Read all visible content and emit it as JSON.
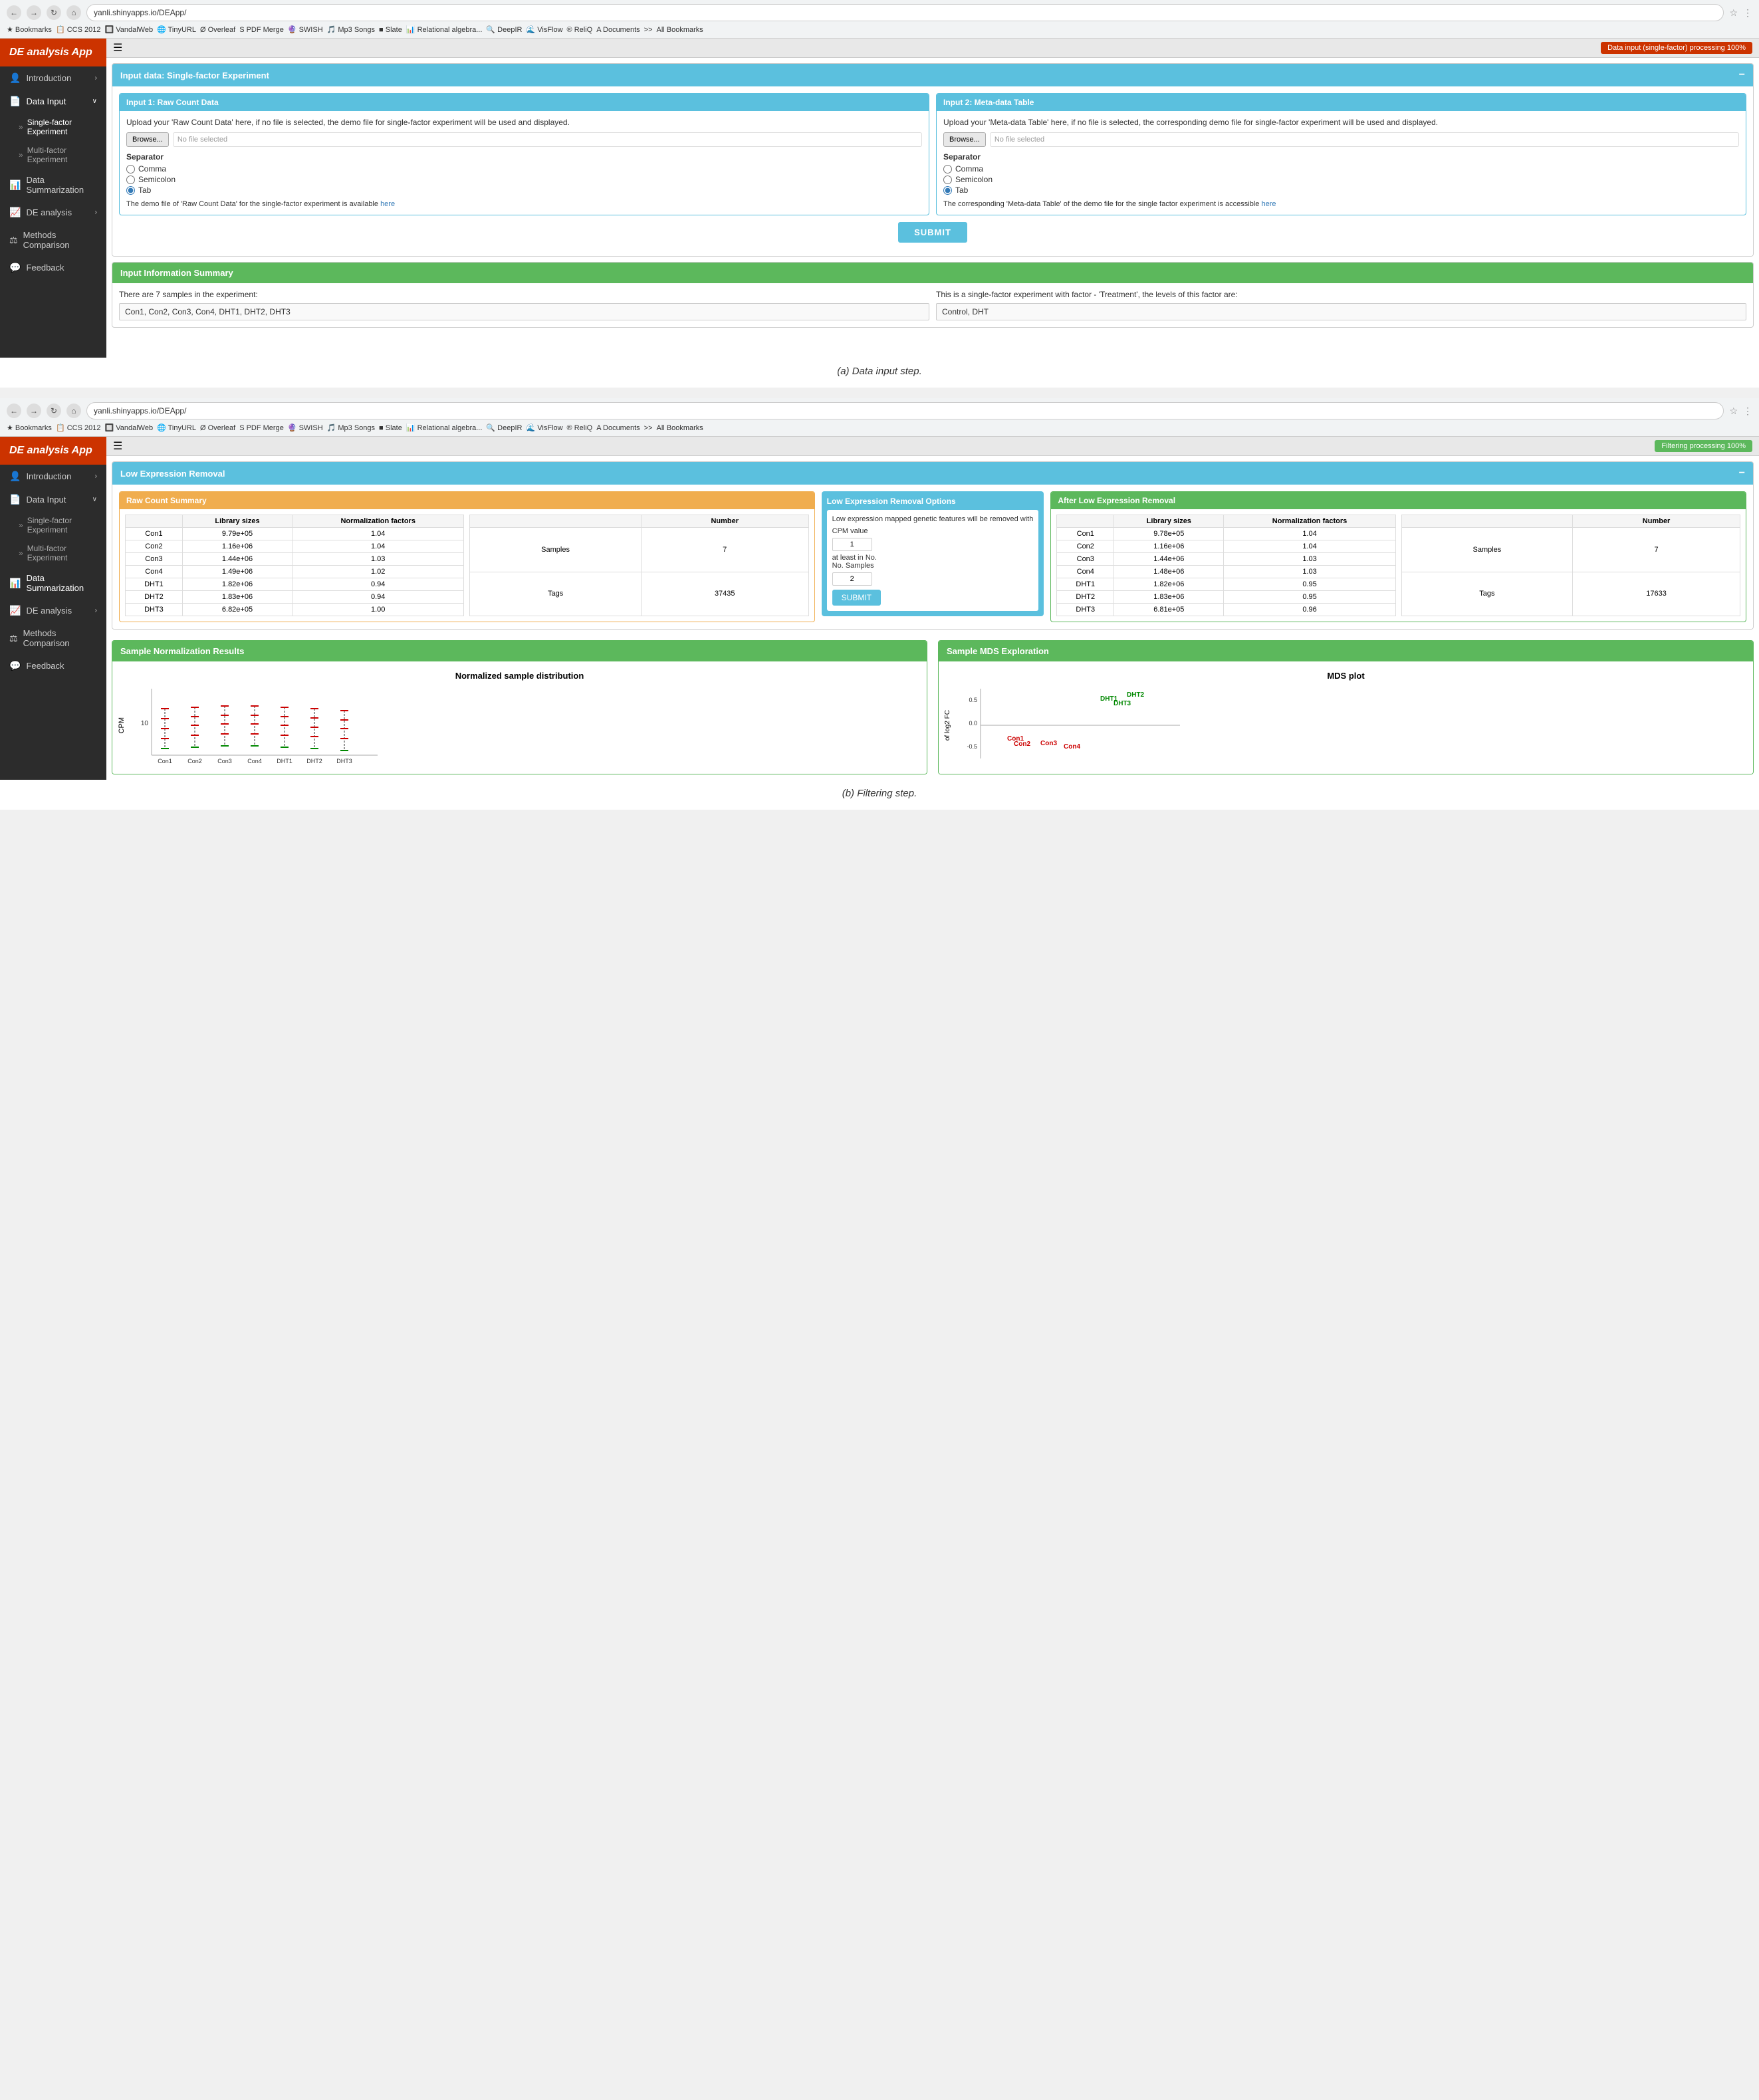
{
  "app": {
    "title": "DE analysis App",
    "url": "yanli.shinyapps.io/DEApp/"
  },
  "bookmarks": [
    "Bookmarks",
    "CCS 2012",
    "VandalWeb",
    "TinyURL",
    "Overleaf",
    "PDF Merge",
    "SWISH",
    "Mp3 Songs",
    "Slate",
    "Relational algebra...",
    "DeepIR",
    "VisFlow",
    "ReliQ",
    "Documents",
    ">>",
    "All Bookmarks"
  ],
  "sidebar": {
    "items": [
      {
        "id": "introduction",
        "label": "Introduction",
        "icon": "👤",
        "hasChevron": true
      },
      {
        "id": "data-input",
        "label": "Data Input",
        "icon": "📄",
        "hasChevron": true
      },
      {
        "id": "single-factor",
        "label": "Single-factor Experiment",
        "isSub": true
      },
      {
        "id": "multi-factor",
        "label": "Multi-factor Experiment",
        "isSub": true
      },
      {
        "id": "data-summarization",
        "label": "Data Summarization",
        "icon": "📊"
      },
      {
        "id": "de-analysis",
        "label": "DE analysis",
        "icon": "📈",
        "hasChevron": true
      },
      {
        "id": "methods-comparison",
        "label": "Methods Comparison",
        "icon": "💬"
      },
      {
        "id": "feedback",
        "label": "Feedback",
        "icon": "💬"
      }
    ]
  },
  "screenshot1": {
    "status_badge": "Data input (single-factor) processing 100%",
    "panel_title": "Input data: Single-factor Experiment",
    "input1": {
      "title": "Input 1: Raw Count Data",
      "description": "Upload your 'Raw Count Data' here, if no file is selected, the demo file for single-factor experiment will be used and displayed.",
      "browse_label": "Browse...",
      "file_placeholder": "No file selected",
      "separator_label": "Separator",
      "options": [
        "Comma",
        "Semicolon",
        "Tab"
      ],
      "selected": "Tab",
      "demo_text": "The demo file of 'Raw Count Data' for the single-factor experiment is available",
      "demo_link": "here"
    },
    "input2": {
      "title": "Input 2: Meta-data Table",
      "description": "Upload your 'Meta-data Table' here, if no file is selected, the corresponding demo file for single-factor experiment will be used and displayed.",
      "browse_label": "Browse...",
      "file_placeholder": "No file selected",
      "separator_label": "Separator",
      "options": [
        "Comma",
        "Semicolon",
        "Tab"
      ],
      "selected": "Tab",
      "demo_text": "The corresponding 'Meta-data Table' of the demo file for the single factor experiment is accessible",
      "demo_link": "here"
    },
    "submit_label": "SUBMIT",
    "info_summary": {
      "title": "Input Information Summary",
      "left_text": "There are 7 samples in the experiment:",
      "left_value": "Con1, Con2, Con3, Con4, DHT1, DHT2, DHT3",
      "right_text": "This is a single-factor experiment with factor - 'Treatment', the levels of this factor are:",
      "right_value": "Control, DHT"
    }
  },
  "caption1": "(a)  Data input step.",
  "screenshot2": {
    "status_badge": "Filtering processing 100%",
    "panel_title": "Low Expression Removal",
    "raw_count_summary": {
      "title": "Raw Count Summary",
      "table_headers": [
        "",
        "Library sizes",
        "Normalization factors"
      ],
      "rows": [
        {
          "name": "Con1",
          "lib_size": "9.79e+05",
          "norm_factor": "1.04"
        },
        {
          "name": "Con2",
          "lib_size": "1.16e+06",
          "norm_factor": "1.04"
        },
        {
          "name": "Con3",
          "lib_size": "1.44e+06",
          "norm_factor": "1.03"
        },
        {
          "name": "Con4",
          "lib_size": "1.49e+06",
          "norm_factor": "1.02"
        },
        {
          "name": "DHT1",
          "lib_size": "1.82e+06",
          "norm_factor": "0.94"
        },
        {
          "name": "DHT2",
          "lib_size": "1.83e+06",
          "norm_factor": "0.94"
        },
        {
          "name": "DHT3",
          "lib_size": "6.82e+05",
          "norm_factor": "1.00"
        }
      ],
      "number_table_headers": [
        "",
        "Number"
      ],
      "number_rows": [
        {
          "label": "Samples",
          "value": "7"
        },
        {
          "label": "Tags",
          "value": "37435"
        }
      ]
    },
    "low_expr_options": {
      "title": "Low Expression Removal Options",
      "description": "Low expression mapped genetic features will be removed with",
      "cpm_label": "CPM value",
      "cpm_value": "1",
      "at_least_label": "at least in",
      "no_samples_label": "No. Samples",
      "no_samples_value": "2",
      "submit_label": "SUBMIT"
    },
    "after_removal": {
      "title": "After Low Expression Removal",
      "table_headers": [
        "",
        "Library sizes",
        "Normalization factors"
      ],
      "rows": [
        {
          "name": "Con1",
          "lib_size": "9.78e+05",
          "norm_factor": "1.04"
        },
        {
          "name": "Con2",
          "lib_size": "1.16e+06",
          "norm_factor": "1.04"
        },
        {
          "name": "Con3",
          "lib_size": "1.44e+06",
          "norm_factor": "1.03"
        },
        {
          "name": "Con4",
          "lib_size": "1.48e+06",
          "norm_factor": "1.03"
        },
        {
          "name": "DHT1",
          "lib_size": "1.82e+06",
          "norm_factor": "0.95"
        },
        {
          "name": "DHT2",
          "lib_size": "1.83e+06",
          "norm_factor": "0.95"
        },
        {
          "name": "DHT3",
          "lib_size": "6.81e+05",
          "norm_factor": "0.96"
        }
      ],
      "number_rows": [
        {
          "label": "Samples",
          "value": "7"
        },
        {
          "label": "Tags",
          "value": "17633"
        }
      ]
    },
    "sample_norm": {
      "title": "Sample Normalization Results",
      "chart_title": "Normalized sample distribution",
      "y_label": "CPM"
    },
    "sample_mds": {
      "title": "Sample MDS Exploration",
      "chart_title": "MDS plot",
      "y_label": "of log2 FC"
    }
  },
  "caption2": "(b)  Filtering step."
}
